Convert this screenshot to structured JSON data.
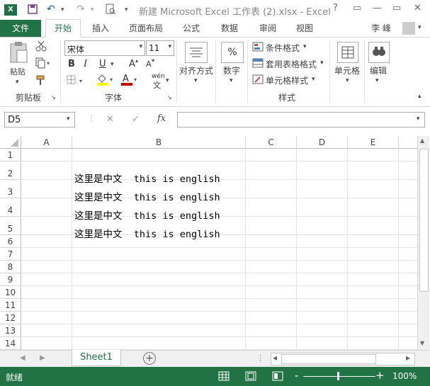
{
  "window": {
    "title": "新建 Microsoft Excel 工作表 (2).xlsx - Excel",
    "help": "?",
    "minimize": "—",
    "restore": "▭",
    "close": "✕"
  },
  "tabs": [
    "文件",
    "开始",
    "插入",
    "页面布局",
    "公式",
    "数据",
    "审阅",
    "视图"
  ],
  "user": "李 峰",
  "ribbon": {
    "clipboard": {
      "paste": "粘贴",
      "label": "剪贴板"
    },
    "font": {
      "name": "宋体",
      "size": "11",
      "bold": "B",
      "italic": "I",
      "underline": "U",
      "grow": "A",
      "shrink": "A",
      "wen": "wén",
      "label": "字体"
    },
    "align": {
      "label": "对齐方式"
    },
    "number": {
      "label": "数字",
      "symbol": "%"
    },
    "styles": {
      "conditional": "条件格式",
      "table": "套用表格格式",
      "cell": "单元格样式",
      "label": "样式"
    },
    "cells": {
      "label": "单元格"
    },
    "edit": {
      "label": "编辑"
    }
  },
  "formula_bar": {
    "name_box": "D5",
    "fx": "fx",
    "cancel": "✕",
    "enter": "✓"
  },
  "grid": {
    "columns": [
      "A",
      "B",
      "C",
      "D",
      "E"
    ],
    "rows": [
      "1",
      "2",
      "3",
      "4",
      "5",
      "6",
      "7",
      "8",
      "9",
      "10",
      "11",
      "12",
      "13",
      "14"
    ],
    "cells": [
      "这里是中文  this is english",
      "这里是中文  this is english",
      "这里是中文  this is english",
      "这里是中文  this is english"
    ]
  },
  "sheets": [
    "Sheet1"
  ],
  "status": {
    "ready": "就绪",
    "zoom": "100%",
    "minus": "-",
    "plus": "+"
  }
}
